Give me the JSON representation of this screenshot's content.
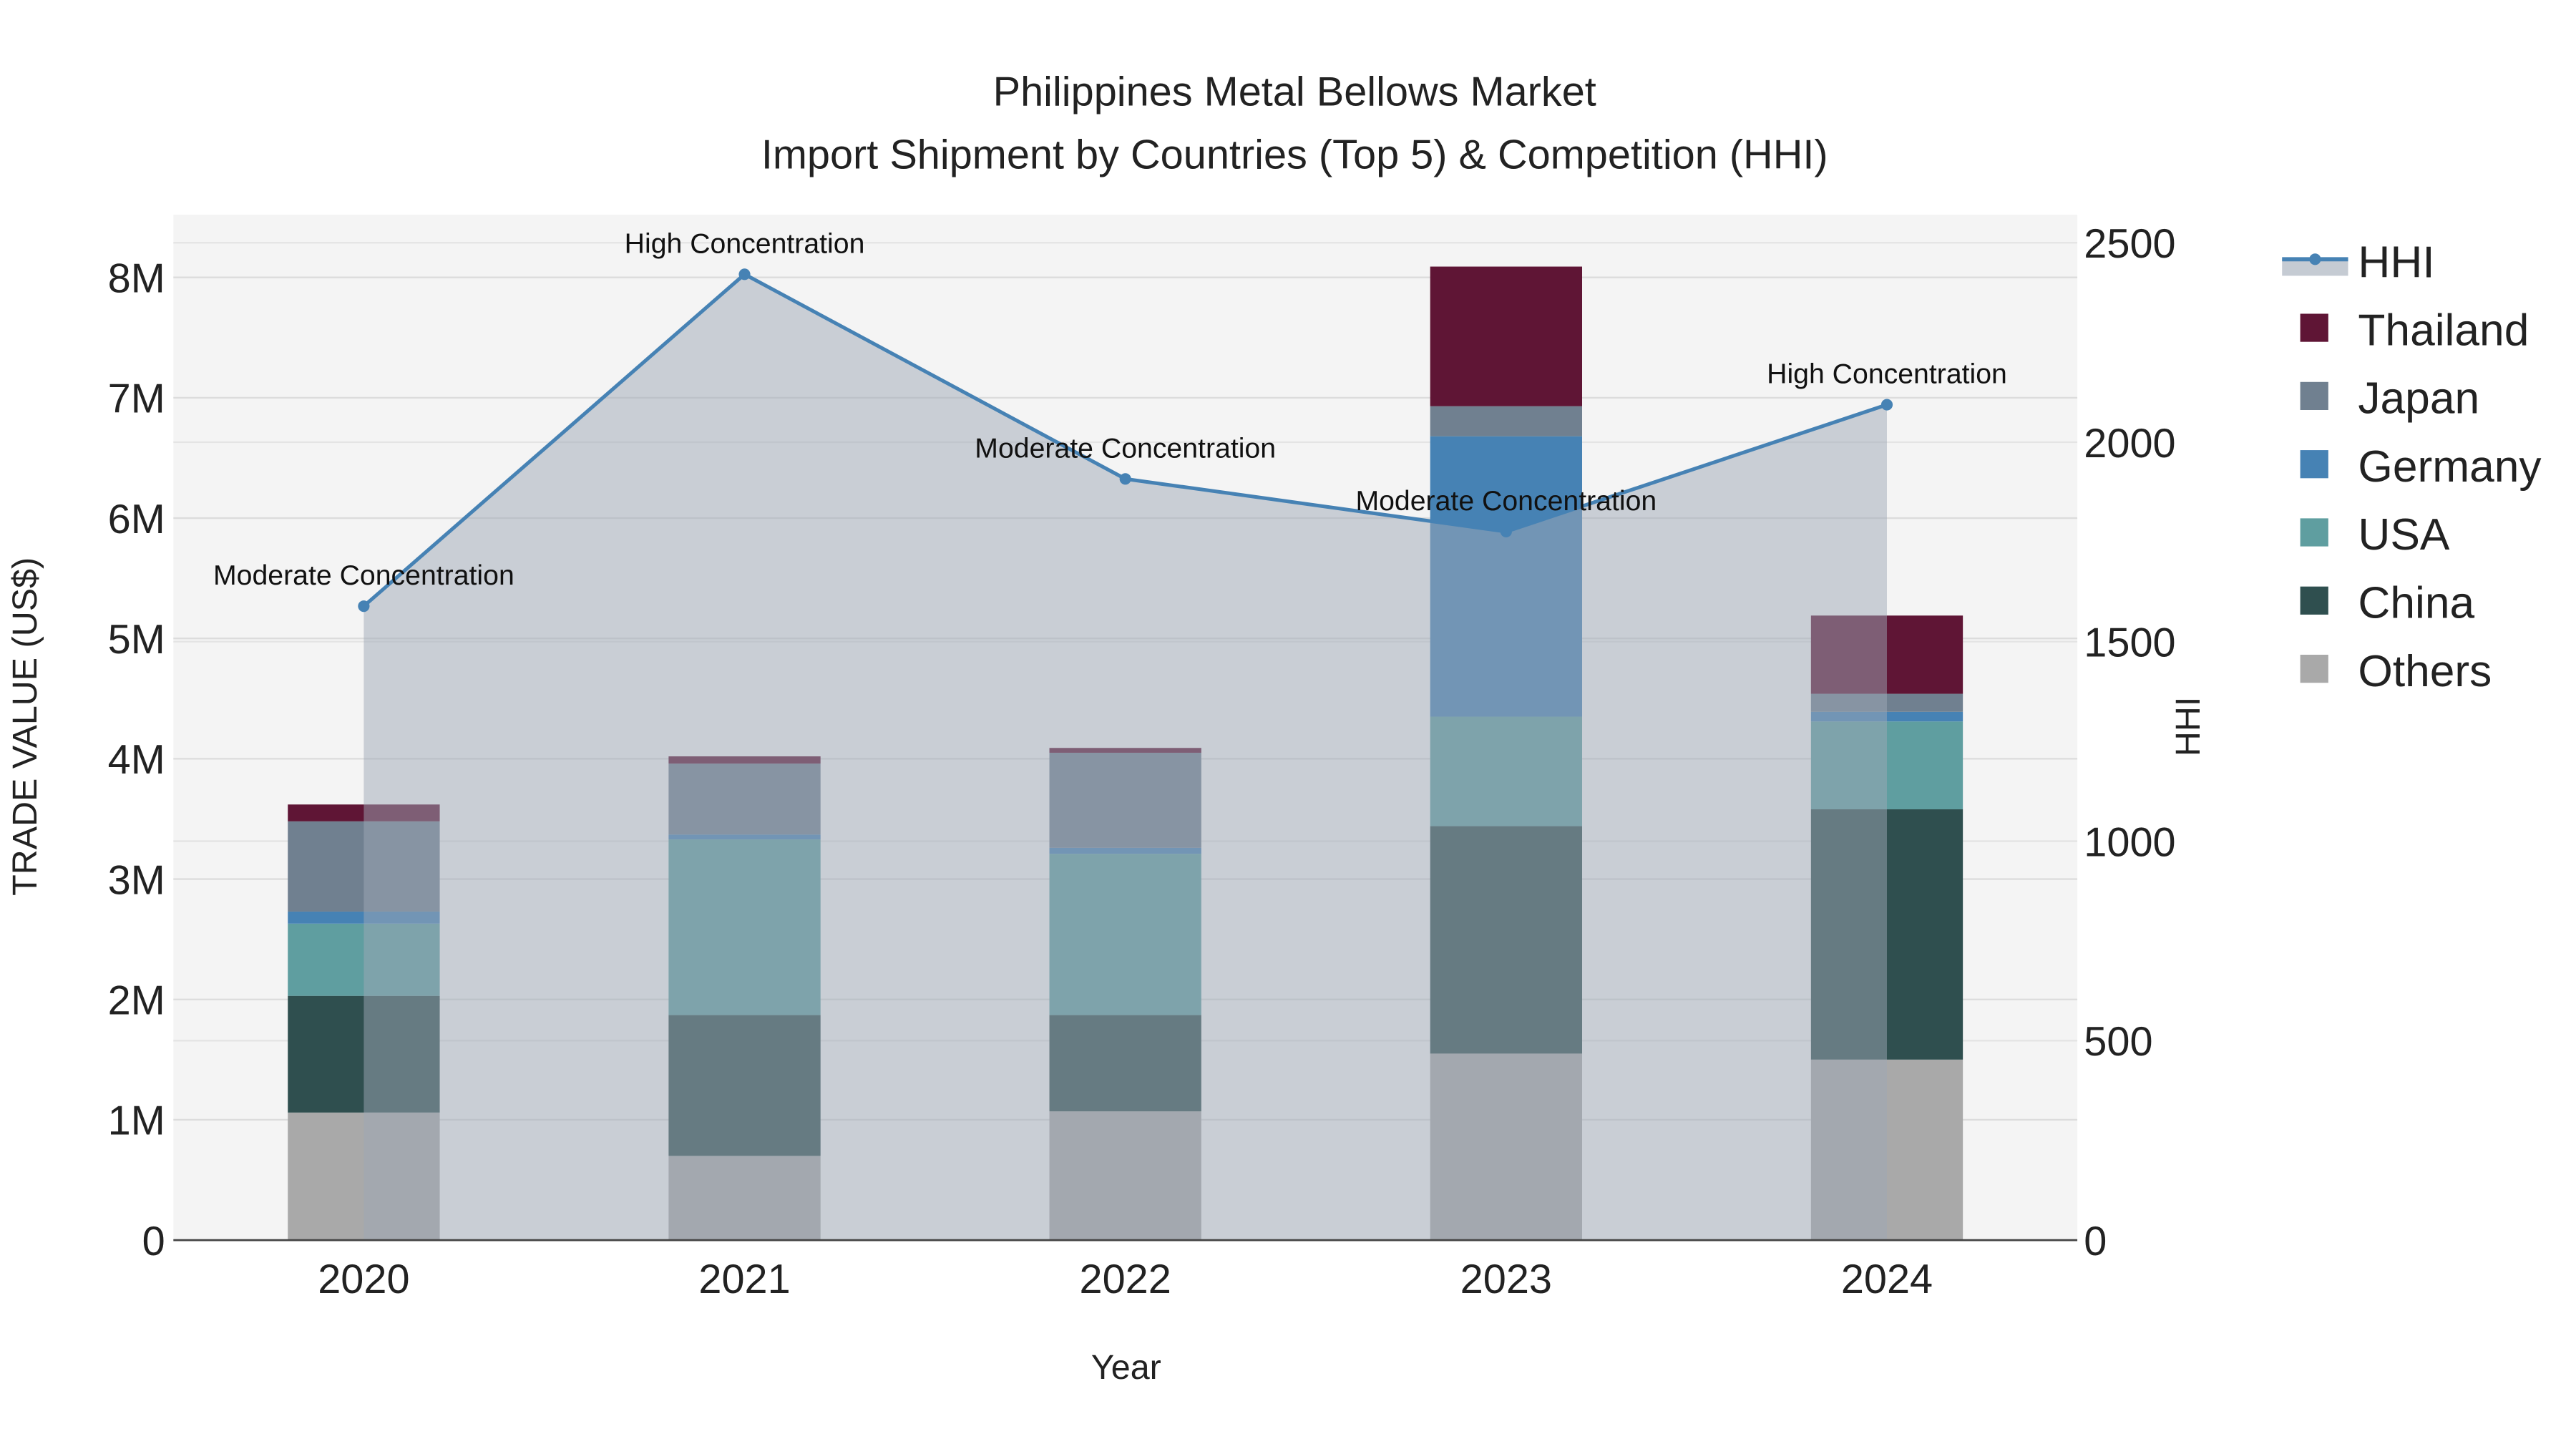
{
  "chart_data": {
    "type": "bar",
    "stacked": true,
    "title": "Philippines Metal Bellows Market",
    "subtitle": "Import Shipment by Countries (Top 5) & Competition (HHI)",
    "xlabel": "Year",
    "ylabel": "TRADE VALUE (US$)",
    "y2label": "HHI",
    "categories": [
      "2020",
      "2021",
      "2022",
      "2023",
      "2024"
    ],
    "ylim": [
      0,
      8500000
    ],
    "y_ticks": [
      0,
      1000000,
      2000000,
      3000000,
      4000000,
      5000000,
      6000000,
      7000000,
      8000000
    ],
    "y_tick_labels": [
      "0",
      "1M",
      "2M",
      "3M",
      "4M",
      "5M",
      "6M",
      "7M",
      "8M"
    ],
    "y2lim": [
      0,
      2570
    ],
    "y2_ticks": [
      0,
      500,
      1000,
      1500,
      2000,
      2500
    ],
    "y2_tick_labels": [
      "0",
      "500",
      "1000",
      "1500",
      "2000",
      "2500"
    ],
    "series": [
      {
        "name": "Others",
        "color": "#a9a9a9",
        "values": [
          1060000,
          700000,
          1070000,
          1550000,
          1500000
        ]
      },
      {
        "name": "China",
        "color": "#2f4f4f",
        "values": [
          970000,
          1170000,
          800000,
          1890000,
          2080000
        ]
      },
      {
        "name": "USA",
        "color": "#5f9ea0",
        "values": [
          600000,
          1460000,
          1340000,
          910000,
          730000
        ]
      },
      {
        "name": "Germany",
        "color": "#4682b4",
        "values": [
          100000,
          40000,
          50000,
          2330000,
          80000
        ]
      },
      {
        "name": "Japan",
        "color": "#708090",
        "values": [
          750000,
          590000,
          790000,
          250000,
          150000
        ]
      },
      {
        "name": "Thailand",
        "color": "#5f1535",
        "values": [
          140000,
          60000,
          40000,
          1160000,
          650000
        ]
      }
    ],
    "hhi": {
      "name": "HHI",
      "color": "#4682b4",
      "values": [
        1589,
        2421,
        1908,
        1776,
        2094
      ],
      "annotations": [
        "Moderate Concentration",
        "High Concentration",
        "Moderate Concentration",
        "Moderate Concentration",
        "High Concentration"
      ]
    },
    "legend": {
      "placement": "right",
      "entries": [
        "HHI",
        "Thailand",
        "Japan",
        "Germany",
        "USA",
        "China",
        "Others"
      ]
    },
    "grid": true
  }
}
